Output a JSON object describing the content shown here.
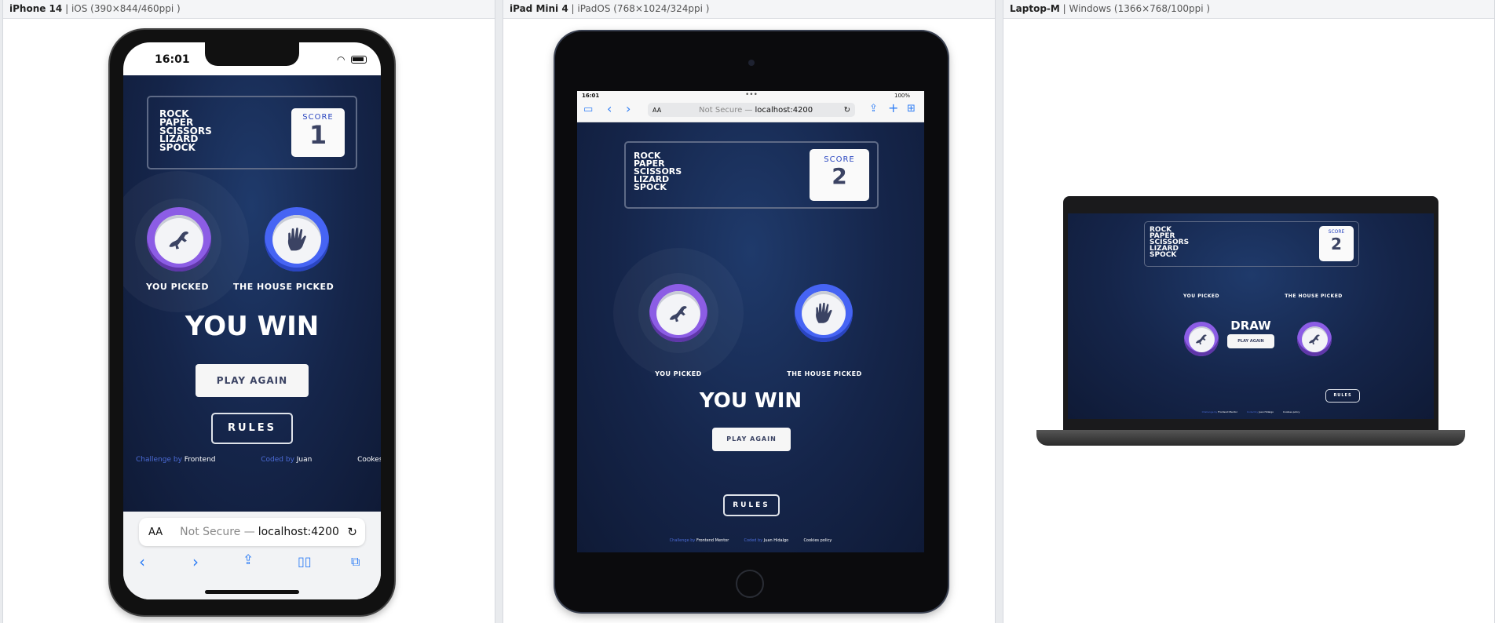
{
  "panels": [
    {
      "device": "iPhone 14",
      "detail": " | iOS (390×844/460ppi )"
    },
    {
      "device": "iPad Mini 4",
      "detail": " | iPadOS (768×1024/324ppi )"
    },
    {
      "device": "Laptop-M",
      "detail": " | Windows (1366×768/100ppi )"
    }
  ],
  "game_title": [
    "ROCK",
    "PAPER",
    "SCISSORS",
    "LIZARD",
    "SPOCK"
  ],
  "score_label": "SCORE",
  "phone": {
    "time": "16:01",
    "score": "1",
    "you_picked": "YOU PICKED",
    "house_picked": "THE HOUSE PICKED",
    "result": "YOU WIN",
    "play_again": "PLAY AGAIN",
    "rules": "RULES",
    "footer": {
      "challenge_by": "Challenge by",
      "challenge_name": "Frontend",
      "coded_by": "Coded by",
      "coder": "Juan",
      "cookies": "Cookes"
    },
    "url_aa": "AA",
    "url_not_secure": "Not Secure —",
    "url_host": "localhost:4200",
    "you_choice": "lizard",
    "house_choice": "spock"
  },
  "tablet": {
    "time": "16:01",
    "battery": "100%",
    "url_aa": "AA",
    "url_not_secure": "Not Secure —",
    "url_host": "localhost:4200",
    "score": "2",
    "you_picked": "YOU PICKED",
    "house_picked": "THE HOUSE PICKED",
    "result": "YOU WIN",
    "play_again": "PLAY AGAIN",
    "rules": "RULES",
    "footer": {
      "challenge_by": "Challenge by",
      "challenge_name": "Frontend Mentor",
      "coded_by": "Coded by",
      "coder": "Juan Hidalgo",
      "cookies": "Cookies policy"
    },
    "you_choice": "lizard",
    "house_choice": "spock"
  },
  "laptop": {
    "score": "2",
    "you_picked": "YOU PICKED",
    "house_picked": "THE HOUSE PICKED",
    "result": "DRAW",
    "play_again": "PLAY AGAIN",
    "rules": "RULES",
    "footer": {
      "challenge_by": "Challenge by",
      "challenge_name": "Frontend Mentor",
      "coded_by": "Coded by",
      "coder": "Juan Hidalgo",
      "cookies": "Cookies policy"
    },
    "you_choice": "lizard",
    "house_choice": "lizard"
  },
  "colors": {
    "lizard": "#8c5de5",
    "spock": "#4664f4",
    "score_text": "#3b4363",
    "background": "#15254a"
  }
}
